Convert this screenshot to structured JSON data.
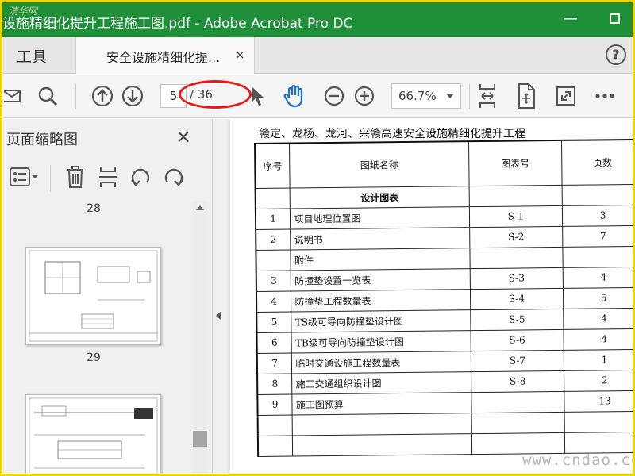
{
  "window": {
    "title": "设施精细化提升工程施工图.pdf - Adobe Acrobat Pro DC",
    "site_watermark": "清华网",
    "minimize": "—"
  },
  "tabs": {
    "tools": "工具",
    "document": "安全设施精细化提...",
    "close": "×",
    "help": "?"
  },
  "toolbar": {
    "page_current": "5",
    "page_total": "/ 36",
    "zoom": "66.7%"
  },
  "left_panel": {
    "title": "页面缩略图",
    "close": "×",
    "page_numbers": [
      "28",
      "29"
    ]
  },
  "document": {
    "heading": "赣定、龙杨、龙河、兴赣高速安全设施精细化提升工程",
    "columns": [
      "序号",
      "图纸名称",
      "图表号",
      "页数"
    ],
    "section": "设计图表",
    "rows": [
      {
        "no": "1",
        "name": "项目地理位置图",
        "code": "S-1",
        "pages": "3"
      },
      {
        "no": "2",
        "name": "说明书",
        "code": "S-2",
        "pages": "7"
      },
      {
        "no": "",
        "name": "附件",
        "code": "",
        "pages": ""
      },
      {
        "no": "3",
        "name": "防撞垫设置一览表",
        "code": "S-3",
        "pages": "4"
      },
      {
        "no": "4",
        "name": "防撞垫工程数量表",
        "code": "S-4",
        "pages": "5"
      },
      {
        "no": "5",
        "name": "TS级可导向防撞垫设计图",
        "code": "S-5",
        "pages": "4"
      },
      {
        "no": "6",
        "name": "TB级可导向防撞垫设计图",
        "code": "S-6",
        "pages": "4"
      },
      {
        "no": "7",
        "name": "临时交通设施工程数量表",
        "code": "S-7",
        "pages": "1"
      },
      {
        "no": "8",
        "name": "施工交通组织设计图",
        "code": "S-8",
        "pages": "2"
      },
      {
        "no": "9",
        "name": "施工图预算",
        "code": "",
        "pages": "13"
      },
      {
        "no": "",
        "name": "",
        "code": "",
        "pages": ""
      },
      {
        "no": "",
        "name": "",
        "code": "",
        "pages": ""
      }
    ],
    "watermark": "www.cndao.com"
  },
  "colors": {
    "titlebar": "#1f8f3a",
    "frame": "#ecd400",
    "annotation": "#e41b1b",
    "hand_tool": "#1a73c9"
  },
  "icons": [
    "mail-icon",
    "search-icon",
    "page-up-icon",
    "page-down-icon",
    "select-cursor-icon",
    "hand-icon",
    "zoom-out-icon",
    "zoom-in-icon",
    "fit-page-icon",
    "rotate-page-icon",
    "full-screen-icon",
    "more-icon",
    "options-icon",
    "delete-icon",
    "insert-page-icon",
    "undo-icon",
    "redo-icon"
  ]
}
